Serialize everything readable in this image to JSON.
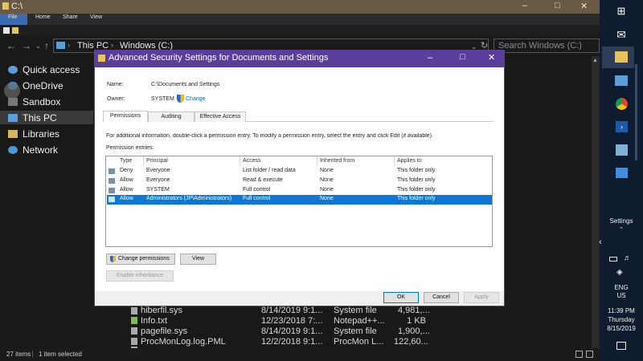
{
  "explorer": {
    "title": "C:\\",
    "ribbon_tabs": [
      "File",
      "Home",
      "Share",
      "View"
    ],
    "address": "This PC  >  Windows (C:)",
    "address_parts": [
      "This PC",
      "Windows (C:)"
    ],
    "search_placeholder": "Search Windows (C:)",
    "nav": [
      "Quick access",
      "OneDrive",
      "Sandbox",
      "This PC",
      "Libraries",
      "Network"
    ],
    "files": [
      {
        "name": "hiberfil.sys",
        "date": "8/14/2019 9:1...",
        "type": "System file",
        "size": "4,981,..."
      },
      {
        "name": "Info.txt",
        "date": "12/23/2018 7:...",
        "type": "Notepad++...",
        "size": "1 KB"
      },
      {
        "name": "pagefile.sys",
        "date": "8/14/2019 9:1...",
        "type": "System file",
        "size": "1,900,..."
      },
      {
        "name": "ProcMonLog.log.PML",
        "date": "12/2/2018 9:1...",
        "type": "ProcMon L...",
        "size": "122,60..."
      },
      {
        "name": "",
        "date": "",
        "type": "",
        "size": ""
      }
    ],
    "status_items": "27 items",
    "status_selected": "1 item selected"
  },
  "taskbar": {
    "settings_label": "Settings",
    "language": "ENG",
    "region": "US",
    "time": "11:39 PM",
    "day": "Thursday",
    "date": "8/15/2019"
  },
  "dialog": {
    "title": "Advanced Security Settings for Documents and Settings",
    "name_label": "Name:",
    "name_value": "C:\\Documents and Settings",
    "owner_label": "Owner:",
    "owner_value": "SYSTEM",
    "change_link": "Change",
    "tabs": [
      "Permissions",
      "Auditing",
      "Effective Access"
    ],
    "info_text": "For additional information, double-click a permission entry. To modify a permission entry, select the entry and click Edit (if available).",
    "entries_label": "Permission entries:",
    "columns": [
      "Type",
      "Principal",
      "Access",
      "Inherited from",
      "Applies to"
    ],
    "rows": [
      {
        "type": "Deny",
        "principal": "Everyone",
        "access": "List folder / read data",
        "inherited": "None",
        "applies": "This folder only"
      },
      {
        "type": "Allow",
        "principal": "Everyone",
        "access": "Read & execute",
        "inherited": "None",
        "applies": "This folder only"
      },
      {
        "type": "Allow",
        "principal": "SYSTEM",
        "access": "Full control",
        "inherited": "None",
        "applies": "This folder only"
      },
      {
        "type": "Allow",
        "principal": "Administrators (JP\\Administrators)",
        "access": "Full control",
        "inherited": "None",
        "applies": "This folder only"
      }
    ],
    "change_permissions": "Change permissions",
    "view": "View",
    "enable_inheritance": "Enable inheritance",
    "ok": "OK",
    "cancel": "Cancel",
    "apply": "Apply"
  }
}
